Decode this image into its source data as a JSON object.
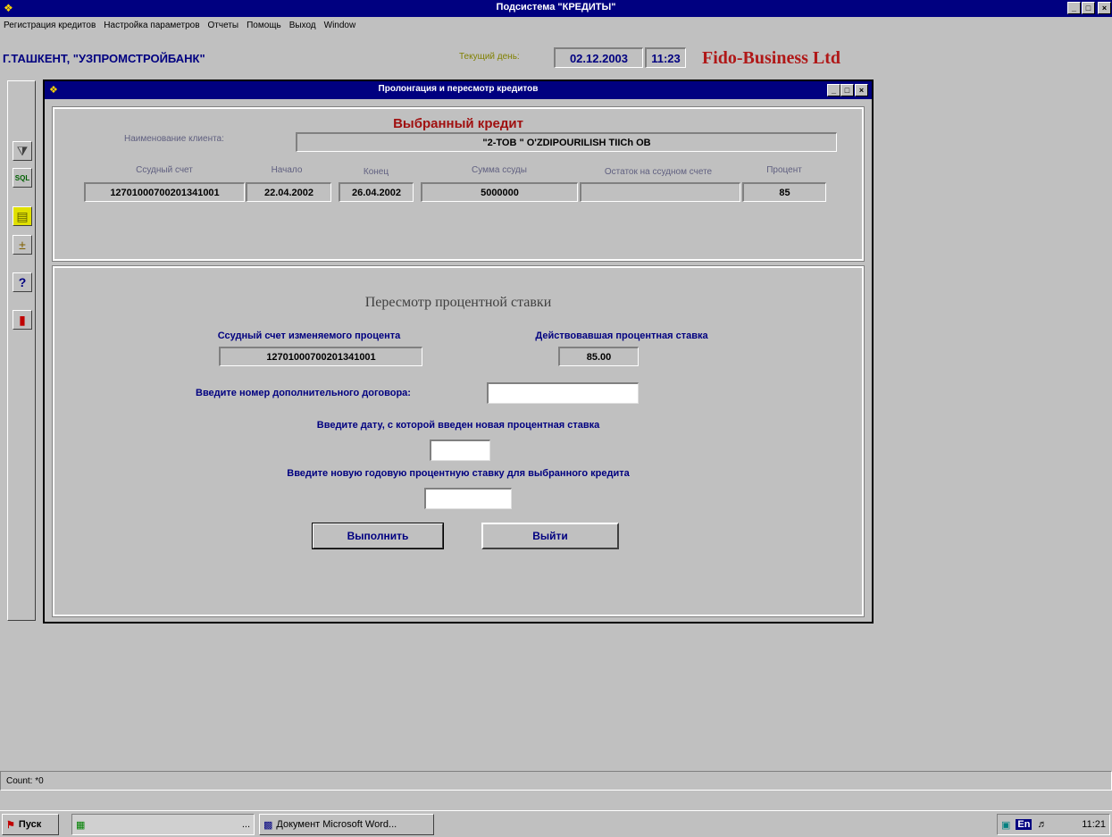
{
  "app": {
    "title": "Подсистема \"КРЕДИТЫ\"",
    "controls": [
      "_",
      "□",
      "×"
    ]
  },
  "menu": {
    "items": [
      "Регистрация кредитов",
      "Настройка параметров",
      "Отчеты",
      "Помощь",
      "Выход",
      "Window"
    ]
  },
  "info": {
    "bank_name": "Г.ТАШКЕНТ, \"УЗПРОМСТРОЙБАНК\"",
    "day_label": "Текущий день:",
    "date": "02.12.2003",
    "time": "11:23",
    "brand": "Fido-Business Ltd"
  },
  "toolbar": {
    "icons": [
      "filter-icon",
      "sql-icon",
      "note-icon",
      "calculator-icon",
      "help-icon",
      "exit-icon"
    ],
    "glyphs": [
      "⧩",
      "SQL",
      "▤",
      "±",
      "?",
      "▮"
    ]
  },
  "child": {
    "title": "Пролонгация и пересмотр кредитов",
    "controls": [
      "_",
      "□",
      "×"
    ]
  },
  "selected_credit": {
    "heading": "Выбранный кредит",
    "client_label": "Наименование клиента:",
    "client_name": "\"2-TOB \" O'ZDIPOURILISH TIICh OB",
    "columns": [
      "Ссудный счет",
      "Начало",
      "Конец",
      "Сумма ссуды",
      "Остаток на ссудном счете",
      "Процент"
    ],
    "values": [
      "12701000700201341001",
      "22.04.2002",
      "26.04.2002",
      "5000000",
      "",
      "85"
    ]
  },
  "revision": {
    "heading": "Пересмотр процентной ставки",
    "account_label": "Ссудный счет изменяемого процента",
    "account_value": "12701000700201341001",
    "rate_label": "Действовавшая процентная ставка",
    "rate_value": "85.00",
    "contract_label": "Введите номер дополнительного договора:",
    "contract_value": "",
    "date_label": "Введите дату, с которой введен новая процентная ставка",
    "date_value": "",
    "new_rate_label": "Введите новую годовую процентную ставку для выбранного кредита",
    "new_rate_value": "",
    "execute_label": "Выполнить",
    "exit_label": "Выйти"
  },
  "status": {
    "text": "Count: *0"
  },
  "taskbar": {
    "start_label": "Пуск",
    "task1_label": "...",
    "task2_label": "Документ Microsoft Word...",
    "tray_lang": "En",
    "clock": "11:21"
  },
  "colors": {
    "title_bar": "#000080",
    "face": "#c0c0c0",
    "accent_red": "#b01818",
    "label_blue": "#000080"
  }
}
